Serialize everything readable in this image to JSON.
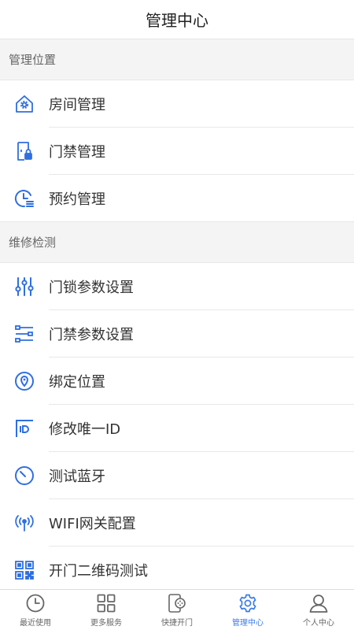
{
  "header": {
    "title": "管理中心"
  },
  "colors": {
    "accent": "#3a7bea",
    "icon": "#2f6fe0",
    "inactive": "#666666"
  },
  "sections": [
    {
      "title": "管理位置",
      "items": [
        {
          "label": "房间管理",
          "icon": "house-icon"
        },
        {
          "label": "门禁管理",
          "icon": "door-lock-icon"
        },
        {
          "label": "预约管理",
          "icon": "clock-list-icon"
        }
      ]
    },
    {
      "title": "维修检测",
      "items": [
        {
          "label": "门锁参数设置",
          "icon": "sliders-icon"
        },
        {
          "label": "门禁参数设置",
          "icon": "settings-list-icon"
        },
        {
          "label": "绑定位置",
          "icon": "location-icon"
        },
        {
          "label": "修改唯一ID",
          "icon": "id-icon"
        },
        {
          "label": "测试蓝牙",
          "icon": "gauge-icon"
        },
        {
          "label": "WIFI网关配置",
          "icon": "wifi-signal-icon"
        },
        {
          "label": "开门二维码测试",
          "icon": "qr-code-icon"
        }
      ]
    }
  ],
  "tabs": [
    {
      "label": "最近使用",
      "icon": "clock-icon",
      "active": false
    },
    {
      "label": "更多服务",
      "icon": "grid-icon",
      "active": false
    },
    {
      "label": "快捷开门",
      "icon": "phone-unlock-icon",
      "active": false
    },
    {
      "label": "管理中心",
      "icon": "gear-icon",
      "active": true
    },
    {
      "label": "个人中心",
      "icon": "person-icon",
      "active": false
    }
  ]
}
